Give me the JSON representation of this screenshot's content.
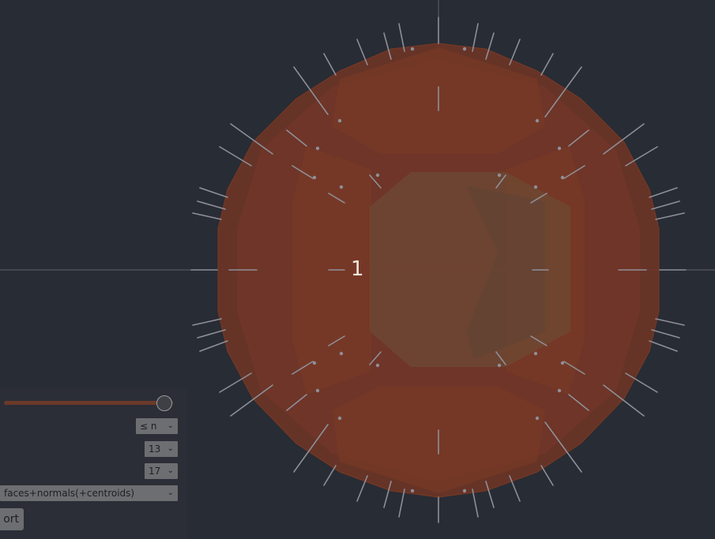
{
  "viewport": {
    "shape_label": "1"
  },
  "colors": {
    "background": "#282c35",
    "shape_fill": "#8a3f22",
    "shape_edge": "#7a3a22",
    "normal_line": "#8e8f98",
    "axis_line": "#5f6068",
    "panel_bg": "#2b2e36",
    "control_bg": "#6d6e72",
    "slider_track": "#6b3a2a"
  },
  "controls": {
    "slider_level": 0.95,
    "relation_select": "≤ n",
    "value_select_a": "13",
    "value_select_b": "17",
    "display_mode_select": "faces+normals(+centroids)",
    "export_button": "ort"
  },
  "icons": {
    "chevron": "chevron-down-icon"
  }
}
